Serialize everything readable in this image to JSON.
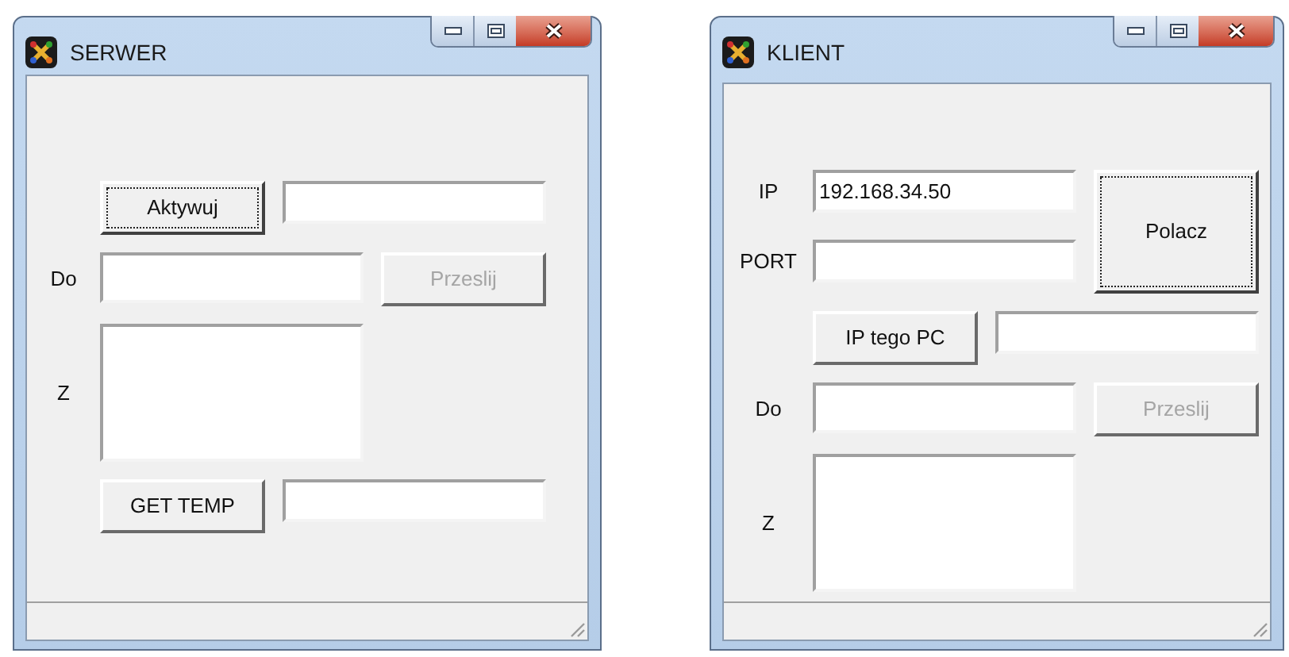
{
  "windows": [
    {
      "title": "SERWER",
      "rows": [
        {
          "items": [
            {
              "kind": "spacer"
            },
            {
              "kind": "button",
              "label": "Aktywuj",
              "focused": true,
              "disabled": false
            },
            {
              "kind": "field"
            }
          ]
        },
        {
          "items": [
            {
              "kind": "label",
              "text": "Do"
            },
            {
              "kind": "field",
              "tall": true
            },
            {
              "kind": "button",
              "label": "Przeslij",
              "focused": false,
              "disabled": true
            }
          ]
        },
        {
          "items": [
            {
              "kind": "label",
              "text": "Z"
            },
            {
              "kind": "textarea"
            }
          ]
        },
        {
          "items": [
            {
              "kind": "spacer"
            },
            {
              "kind": "button",
              "label": "GET TEMP",
              "focused": false,
              "disabled": false
            },
            {
              "kind": "field"
            }
          ]
        }
      ]
    },
    {
      "title": "KLIENT",
      "rows": [
        {
          "items": [
            {
              "kind": "stack",
              "rows": [
                {
                  "items": [
                    {
                      "kind": "label",
                      "text": "IP"
                    },
                    {
                      "kind": "field",
                      "value": "192.168.34.50"
                    }
                  ]
                },
                {
                  "items": [
                    {
                      "kind": "label",
                      "text": "PORT"
                    },
                    {
                      "kind": "field"
                    }
                  ]
                }
              ]
            },
            {
              "kind": "button",
              "label": "Polacz",
              "focused": true,
              "disabled": false,
              "tall": true
            }
          ]
        },
        {
          "items": [
            {
              "kind": "spacer"
            },
            {
              "kind": "button",
              "label": "IP tego PC",
              "focused": false,
              "disabled": false
            },
            {
              "kind": "field"
            }
          ]
        },
        {
          "items": [
            {
              "kind": "label",
              "text": "Do"
            },
            {
              "kind": "field",
              "tall": true
            },
            {
              "kind": "button",
              "label": "Przeslij",
              "focused": false,
              "disabled": true
            }
          ]
        },
        {
          "items": [
            {
              "kind": "label",
              "text": "Z"
            },
            {
              "kind": "textarea"
            }
          ]
        }
      ]
    }
  ]
}
